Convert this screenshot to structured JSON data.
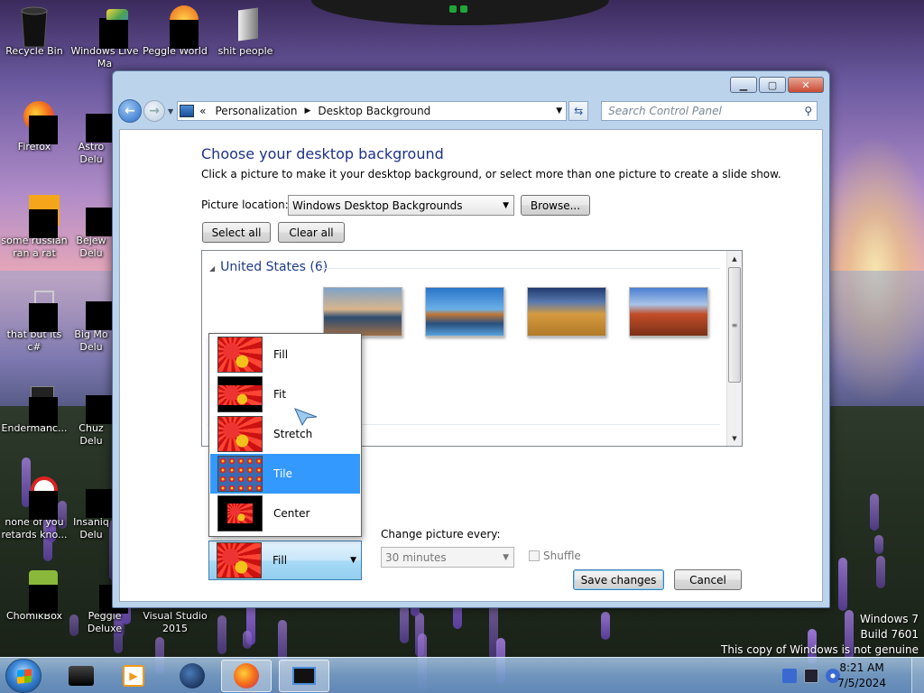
{
  "desktop": {
    "icons": [
      {
        "label": "Recycle Bin",
        "icon": "recycle-bin-icon"
      },
      {
        "label": "Windows Live Ma",
        "icon": "app-icon"
      },
      {
        "label": "Peggle World",
        "icon": "app-icon"
      },
      {
        "label": "shit people",
        "icon": "folder-icon"
      },
      {
        "label": "Firefox",
        "icon": "firefox-icon"
      },
      {
        "label": "Astro Delu",
        "icon": "app-icon"
      },
      {
        "label": "some russian ran a rat",
        "icon": "app-icon"
      },
      {
        "label": "Bejew Delu",
        "icon": "app-icon"
      },
      {
        "label": "that but its c#",
        "icon": "app-icon"
      },
      {
        "label": "Big Mo Delu",
        "icon": "app-icon"
      },
      {
        "label": "Endermanc...",
        "icon": "app-icon"
      },
      {
        "label": "Chuz Delu",
        "icon": "app-icon"
      },
      {
        "label": "none of you retards kno...",
        "icon": "app-icon"
      },
      {
        "label": "Insaniq Delu",
        "icon": "app-icon"
      },
      {
        "label": "ChomikBox",
        "icon": "app-icon"
      },
      {
        "label": "Peggle Deluxe",
        "icon": "app-icon"
      },
      {
        "label": "Visual Studio 2015",
        "icon": "app-icon"
      }
    ],
    "watermark": {
      "line1": "Windows 7",
      "line2": "Build 7601",
      "line3": "This copy of Windows is not genuine"
    }
  },
  "window": {
    "controls": {
      "minimize": "▁",
      "maximize": "▢",
      "close": "✕"
    },
    "breadcrumb": {
      "prefix": "«",
      "items": [
        "Personalization",
        "Desktop Background"
      ]
    },
    "search": {
      "placeholder": "Search Control Panel"
    },
    "title": "Choose your desktop background",
    "description": "Click a picture to make it your desktop background, or select more than one picture to create a slide show.",
    "picture_location": {
      "label": "Picture location:",
      "value": "Windows Desktop Backgrounds",
      "browse": "Browse..."
    },
    "select_all": "Select all",
    "clear_all": "Clear all",
    "gallery": {
      "group": "United States (6)"
    },
    "picture_position": {
      "options": [
        "Fill",
        "Fit",
        "Stretch",
        "Tile",
        "Center"
      ],
      "highlighted": "Tile",
      "selected": "Fill"
    },
    "change_picture": {
      "label": "Change picture every:",
      "value": "30 minutes"
    },
    "shuffle": "Shuffle",
    "save": "Save changes",
    "cancel": "Cancel"
  },
  "taskbar": {
    "time": "8:21 AM",
    "date": "7/5/2024"
  }
}
